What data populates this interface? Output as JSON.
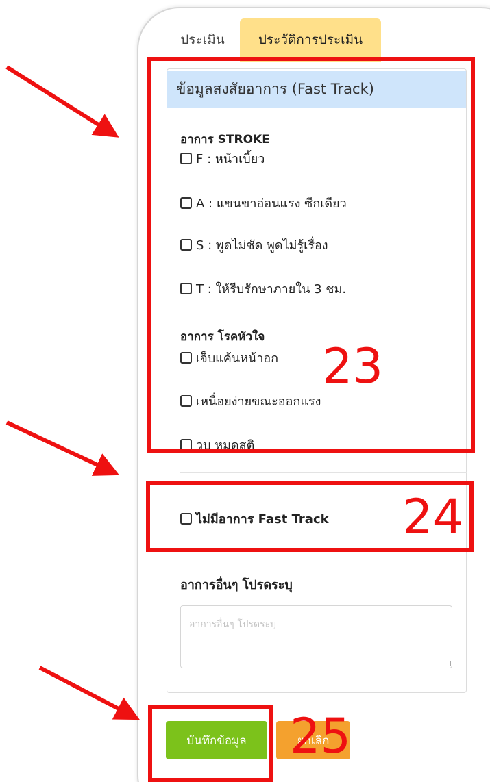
{
  "tabs": {
    "assess": "ประเมิน",
    "history": "ประวัติการประเมิน"
  },
  "card": {
    "header": "ข้อมูลสงสัยอาการ (Fast Track)"
  },
  "stroke": {
    "title": "อาการ STROKE",
    "options": [
      "F : หน้าเบี้ยว",
      "A : แขนขาอ่อนแรง ซีกเดียว",
      "S : พูดไม่ชัด พูดไม่รู้เรื่อง",
      "T : ให้รีบรักษาภายใน 3 ชม."
    ]
  },
  "heart": {
    "title": "อาการ โรคหัวใจ",
    "options": [
      "เจ็บแค้นหน้าอก",
      "เหนื่อยง่ายขณะออกแรง",
      "วูบ หมดสติ"
    ]
  },
  "no_fast_track": "ไม่มีอาการ Fast Track",
  "other": {
    "label": "อาการอื่นๆ โปรดระบุ",
    "placeholder": "อาการอื่นๆ โปรดระบุ",
    "value": ""
  },
  "buttons": {
    "save": "บันทึกข้อมูล",
    "cancel": "ยกเลิก"
  },
  "annotations": {
    "box1": "23",
    "box2": "24",
    "box3": "25"
  },
  "colors": {
    "tab_active": "#ffe08a",
    "card_header": "#cfe5fb",
    "save": "#7cc21b",
    "cancel": "#f4a12e",
    "annotation": "#ee1111"
  }
}
